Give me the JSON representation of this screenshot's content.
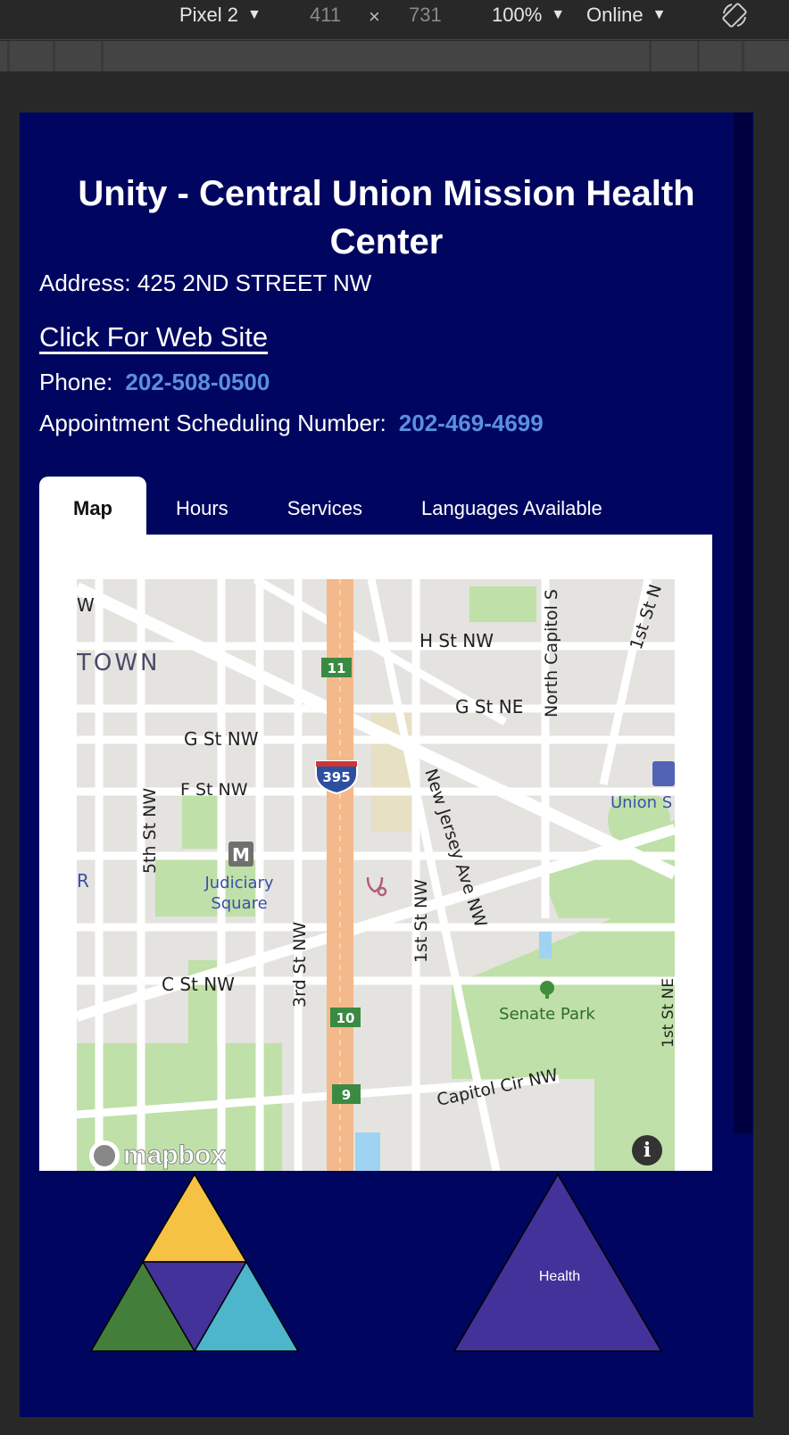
{
  "devtools": {
    "device": "Pixel 2",
    "width": "411",
    "times": "×",
    "height": "731",
    "zoom": "100%",
    "network": "Online",
    "caret": "▼"
  },
  "page": {
    "title": "Unity - Central Union Mission Health Center",
    "address": "Address: 425 2ND STREET NW",
    "website_link": "Click For Web Site",
    "phone_label": "Phone:",
    "phone": "202-508-0500",
    "appt_label": "Appointment Scheduling Number:",
    "appt_phone": "202-469-4699"
  },
  "tabs": [
    {
      "label": "Map",
      "active": true
    },
    {
      "label": "Hours",
      "active": false
    },
    {
      "label": "Services",
      "active": false
    },
    {
      "label": "Languages Available",
      "active": false
    }
  ],
  "map": {
    "labels": {
      "h_st": "H St NW",
      "g_st_ne": "G St NE",
      "north_capitol": "North Capitol S",
      "first_st_ne": "1st St N",
      "town": "TOWN",
      "w": "W",
      "g_st_nw": "G St NW",
      "f_st_nw": "F St NW",
      "fifth_st": "5th St NW",
      "judiciary": "Judiciary",
      "square": "Square",
      "r": "R",
      "new_jersey": "New Jersey Ave NW",
      "first_st_nw": "1st St NW",
      "third_st": "3rd St NW",
      "c_st_nw": "C St NW",
      "union": "Union S",
      "senate_park": "Senate Park",
      "capitol_cir": "Capitol Cir NW",
      "first_st_ne_b": "1st St NE",
      "shield_11": "11",
      "shield_10": "10",
      "shield_9": "9",
      "shield_395": "395",
      "metro": "M"
    },
    "attribution": "mapbox",
    "info": "i"
  },
  "footer": {
    "health_label": "Health"
  },
  "colors": {
    "background": "#00065f",
    "phone_link": "#5b8fe0",
    "tri_yellow": "#f6c244",
    "tri_green": "#437f3a",
    "tri_purple": "#433299",
    "tri_cyan": "#4db6cc"
  }
}
